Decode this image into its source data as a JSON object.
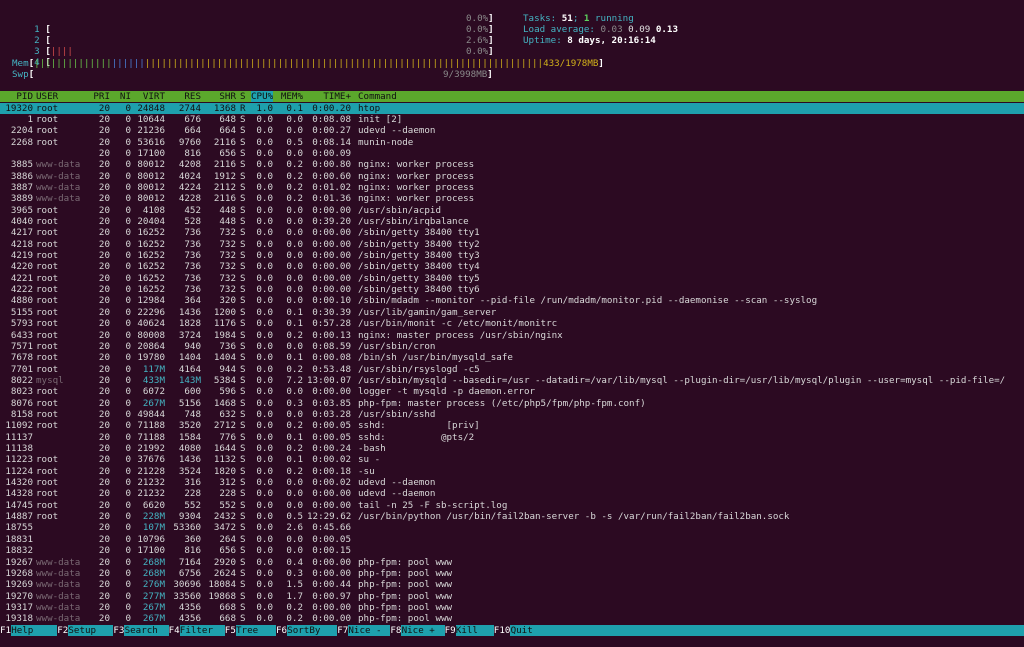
{
  "meters": {
    "cpus": [
      {
        "label": "1",
        "bar": "",
        "bar_color": "red",
        "value": "0.0%"
      },
      {
        "label": "2",
        "bar": "",
        "bar_color": "red",
        "value": "0.0%"
      },
      {
        "label": "3",
        "bar": "||||",
        "bar_color": "red",
        "value": "2.6%"
      },
      {
        "label": "4",
        "bar": "",
        "bar_color": "red",
        "value": "0.0%"
      }
    ],
    "mem": {
      "label": "Mem",
      "bar_green": "||||||||||||||",
      "bar_blue": "||||||",
      "bar_yellow": "||||||||||||||||||||||||||||||||||||||||||||||||||||||||||||||||||||||||",
      "value": "433/1978MB"
    },
    "swp": {
      "label": "Swp",
      "value": "9/3998MB"
    }
  },
  "info": {
    "tasks_label": "Tasks:",
    "tasks_count": "51",
    "tasks_sep": ";",
    "running_count": "1",
    "running_label": "running",
    "load_label": "Load average:",
    "load_1": "0.03",
    "load_5": "0.09",
    "load_15": "0.13",
    "uptime_label": "Uptime:",
    "uptime_value": "8 days, 20:16:14"
  },
  "columns": [
    "PID",
    "USER",
    "PRI",
    "NI",
    "VIRT",
    "RES",
    "SHR",
    "S",
    "CPU%",
    "MEM%",
    "TIME+",
    "Command"
  ],
  "sort_column": "CPU%",
  "processes": [
    [
      "19320",
      "root",
      "20",
      "0",
      "24848",
      "2744",
      "1368",
      "R",
      "1.0",
      "0.1",
      "0:00.20",
      "htop"
    ],
    [
      "1",
      "root",
      "20",
      "0",
      "10644",
      "676",
      "648",
      "S",
      "0.0",
      "0.0",
      "0:08.08",
      "init [2]"
    ],
    [
      "2204",
      "root",
      "20",
      "0",
      "21236",
      "664",
      "664",
      "S",
      "0.0",
      "0.0",
      "0:00.27",
      "udevd --daemon"
    ],
    [
      "2268",
      "root",
      "20",
      "0",
      "53616",
      "9760",
      "2116",
      "S",
      "0.0",
      "0.5",
      "0:08.14",
      "munin-node"
    ],
    [
      "",
      "",
      "20",
      "0",
      "17100",
      "816",
      "656",
      "S",
      "0.0",
      "0.0",
      "0:00.09",
      ""
    ],
    [
      "3885",
      "www-data",
      "20",
      "0",
      "80012",
      "4208",
      "2116",
      "S",
      "0.0",
      "0.2",
      "0:00.80",
      "nginx: worker process"
    ],
    [
      "3886",
      "www-data",
      "20",
      "0",
      "80012",
      "4024",
      "1912",
      "S",
      "0.0",
      "0.2",
      "0:00.60",
      "nginx: worker process"
    ],
    [
      "3887",
      "www-data",
      "20",
      "0",
      "80012",
      "4224",
      "2112",
      "S",
      "0.0",
      "0.2",
      "0:01.02",
      "nginx: worker process"
    ],
    [
      "3889",
      "www-data",
      "20",
      "0",
      "80012",
      "4228",
      "2116",
      "S",
      "0.0",
      "0.2",
      "0:01.36",
      "nginx: worker process"
    ],
    [
      "3965",
      "root",
      "20",
      "0",
      "4108",
      "452",
      "448",
      "S",
      "0.0",
      "0.0",
      "0:00.00",
      "/usr/sbin/acpid"
    ],
    [
      "4040",
      "root",
      "20",
      "0",
      "20404",
      "528",
      "448",
      "S",
      "0.0",
      "0.0",
      "0:39.20",
      "/usr/sbin/irqbalance"
    ],
    [
      "4217",
      "root",
      "20",
      "0",
      "16252",
      "736",
      "732",
      "S",
      "0.0",
      "0.0",
      "0:00.00",
      "/sbin/getty 38400 tty1"
    ],
    [
      "4218",
      "root",
      "20",
      "0",
      "16252",
      "736",
      "732",
      "S",
      "0.0",
      "0.0",
      "0:00.00",
      "/sbin/getty 38400 tty2"
    ],
    [
      "4219",
      "root",
      "20",
      "0",
      "16252",
      "736",
      "732",
      "S",
      "0.0",
      "0.0",
      "0:00.00",
      "/sbin/getty 38400 tty3"
    ],
    [
      "4220",
      "root",
      "20",
      "0",
      "16252",
      "736",
      "732",
      "S",
      "0.0",
      "0.0",
      "0:00.00",
      "/sbin/getty 38400 tty4"
    ],
    [
      "4221",
      "root",
      "20",
      "0",
      "16252",
      "736",
      "732",
      "S",
      "0.0",
      "0.0",
      "0:00.00",
      "/sbin/getty 38400 tty5"
    ],
    [
      "4222",
      "root",
      "20",
      "0",
      "16252",
      "736",
      "732",
      "S",
      "0.0",
      "0.0",
      "0:00.00",
      "/sbin/getty 38400 tty6"
    ],
    [
      "4880",
      "root",
      "20",
      "0",
      "12984",
      "364",
      "320",
      "S",
      "0.0",
      "0.0",
      "0:00.10",
      "/sbin/mdadm --monitor --pid-file /run/mdadm/monitor.pid --daemonise --scan --syslog"
    ],
    [
      "5155",
      "root",
      "20",
      "0",
      "22296",
      "1436",
      "1200",
      "S",
      "0.0",
      "0.1",
      "0:30.39",
      "/usr/lib/gamin/gam_server"
    ],
    [
      "5793",
      "root",
      "20",
      "0",
      "40624",
      "1828",
      "1176",
      "S",
      "0.0",
      "0.1",
      "0:57.28",
      "/usr/bin/monit -c /etc/monit/monitrc"
    ],
    [
      "6433",
      "root",
      "20",
      "0",
      "80008",
      "3724",
      "1984",
      "S",
      "0.0",
      "0.2",
      "0:00.13",
      "nginx: master process /usr/sbin/nginx"
    ],
    [
      "7571",
      "root",
      "20",
      "0",
      "20864",
      "940",
      "736",
      "S",
      "0.0",
      "0.0",
      "0:08.59",
      "/usr/sbin/cron"
    ],
    [
      "7678",
      "root",
      "20",
      "0",
      "19780",
      "1404",
      "1404",
      "S",
      "0.0",
      "0.1",
      "0:00.08",
      "/bin/sh /usr/bin/mysqld_safe"
    ],
    [
      "7701",
      "root",
      "20",
      "0",
      "117M",
      "4164",
      "944",
      "S",
      "0.0",
      "0.2",
      "0:53.48",
      "/usr/sbin/rsyslogd -c5"
    ],
    [
      "8022",
      "mysql",
      "20",
      "0",
      "433M",
      "143M",
      "5384",
      "S",
      "0.0",
      "7.2",
      "13:00.07",
      "/usr/sbin/mysqld --basedir=/usr --datadir=/var/lib/mysql --plugin-dir=/usr/lib/mysql/plugin --user=mysql --pid-file=/"
    ],
    [
      "8023",
      "root",
      "20",
      "0",
      "6072",
      "600",
      "596",
      "S",
      "0.0",
      "0.0",
      "0:00.00",
      "logger -t mysqld -p daemon.error"
    ],
    [
      "8076",
      "root",
      "20",
      "0",
      "267M",
      "5156",
      "1468",
      "S",
      "0.0",
      "0.3",
      "0:03.85",
      "php-fpm: master process (/etc/php5/fpm/php-fpm.conf)"
    ],
    [
      "8158",
      "root",
      "20",
      "0",
      "49844",
      "748",
      "632",
      "S",
      "0.0",
      "0.0",
      "0:03.28",
      "/usr/sbin/sshd"
    ],
    [
      "11092",
      "root",
      "20",
      "0",
      "71188",
      "3520",
      "2712",
      "S",
      "0.0",
      "0.2",
      "0:00.05",
      "sshd:           [priv]"
    ],
    [
      "11137",
      "",
      "20",
      "0",
      "71188",
      "1584",
      "776",
      "S",
      "0.0",
      "0.1",
      "0:00.05",
      "sshd:          @pts/2"
    ],
    [
      "11138",
      "",
      "20",
      "0",
      "21992",
      "4080",
      "1644",
      "S",
      "0.0",
      "0.2",
      "0:00.24",
      "-bash"
    ],
    [
      "11223",
      "root",
      "20",
      "0",
      "37676",
      "1436",
      "1132",
      "S",
      "0.0",
      "0.1",
      "0:00.02",
      "su -"
    ],
    [
      "11224",
      "root",
      "20",
      "0",
      "21228",
      "3524",
      "1820",
      "S",
      "0.0",
      "0.2",
      "0:00.18",
      "-su"
    ],
    [
      "14320",
      "root",
      "20",
      "0",
      "21232",
      "316",
      "312",
      "S",
      "0.0",
      "0.0",
      "0:00.02",
      "udevd --daemon"
    ],
    [
      "14328",
      "root",
      "20",
      "0",
      "21232",
      "228",
      "228",
      "S",
      "0.0",
      "0.0",
      "0:00.00",
      "udevd --daemon"
    ],
    [
      "14745",
      "root",
      "20",
      "0",
      "6620",
      "552",
      "552",
      "S",
      "0.0",
      "0.0",
      "0:00.00",
      "tail -n 25 -F sb-script.log"
    ],
    [
      "14887",
      "root",
      "20",
      "0",
      "228M",
      "9304",
      "2432",
      "S",
      "0.0",
      "0.5",
      "12:29.62",
      "/usr/bin/python /usr/bin/fail2ban-server -b -s /var/run/fail2ban/fail2ban.sock"
    ],
    [
      "18755",
      "",
      "20",
      "0",
      "107M",
      "53360",
      "3472",
      "S",
      "0.0",
      "2.6",
      "0:45.66",
      ""
    ],
    [
      "18831",
      "",
      "20",
      "0",
      "10796",
      "360",
      "264",
      "S",
      "0.0",
      "0.0",
      "0:00.05",
      ""
    ],
    [
      "18832",
      "",
      "20",
      "0",
      "17100",
      "816",
      "656",
      "S",
      "0.0",
      "0.0",
      "0:00.15",
      ""
    ],
    [
      "19267",
      "www-data",
      "20",
      "0",
      "268M",
      "7164",
      "2920",
      "S",
      "0.0",
      "0.4",
      "0:00.00",
      "php-fpm: pool www"
    ],
    [
      "19268",
      "www-data",
      "20",
      "0",
      "268M",
      "6756",
      "2624",
      "S",
      "0.0",
      "0.3",
      "0:00.00",
      "php-fpm: pool www"
    ],
    [
      "19269",
      "www-data",
      "20",
      "0",
      "276M",
      "30696",
      "18084",
      "S",
      "0.0",
      "1.5",
      "0:00.44",
      "php-fpm: pool www"
    ],
    [
      "19270",
      "www-data",
      "20",
      "0",
      "277M",
      "33560",
      "19868",
      "S",
      "0.0",
      "1.7",
      "0:00.97",
      "php-fpm: pool www"
    ],
    [
      "19317",
      "www-data",
      "20",
      "0",
      "267M",
      "4356",
      "668",
      "S",
      "0.0",
      "0.2",
      "0:00.00",
      "php-fpm: pool www"
    ],
    [
      "19318",
      "www-data",
      "20",
      "0",
      "267M",
      "4356",
      "668",
      "S",
      "0.0",
      "0.2",
      "0:00.00",
      "php-fpm: pool www"
    ]
  ],
  "fkeys": [
    {
      "key": "F1",
      "label": "Help"
    },
    {
      "key": "F2",
      "label": "Setup"
    },
    {
      "key": "F3",
      "label": "Search"
    },
    {
      "key": "F4",
      "label": "Filter"
    },
    {
      "key": "F5",
      "label": "Tree"
    },
    {
      "key": "F6",
      "label": "SortBy"
    },
    {
      "key": "F7",
      "label": "Nice -"
    },
    {
      "key": "F8",
      "label": "Nice +"
    },
    {
      "key": "F9",
      "label": "Kill"
    },
    {
      "key": "F10",
      "label": "Quit"
    }
  ]
}
